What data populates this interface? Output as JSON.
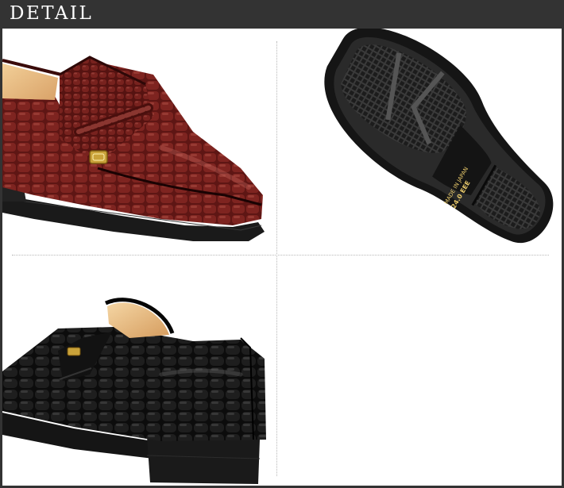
{
  "header": {
    "title": "DETAIL"
  },
  "sole_label": {
    "line1": "MADE IN JAPAN",
    "line2": "24.0 EEE"
  },
  "colors": {
    "header_bg": "#333333",
    "brown_leather": "#6e1a17",
    "black_leather": "#141414",
    "insole_tan": "#e8b878"
  },
  "images": [
    {
      "name": "brown-shoe-toe-image"
    },
    {
      "name": "shoe-sole-image"
    },
    {
      "name": "black-shoe-heel-image"
    }
  ]
}
